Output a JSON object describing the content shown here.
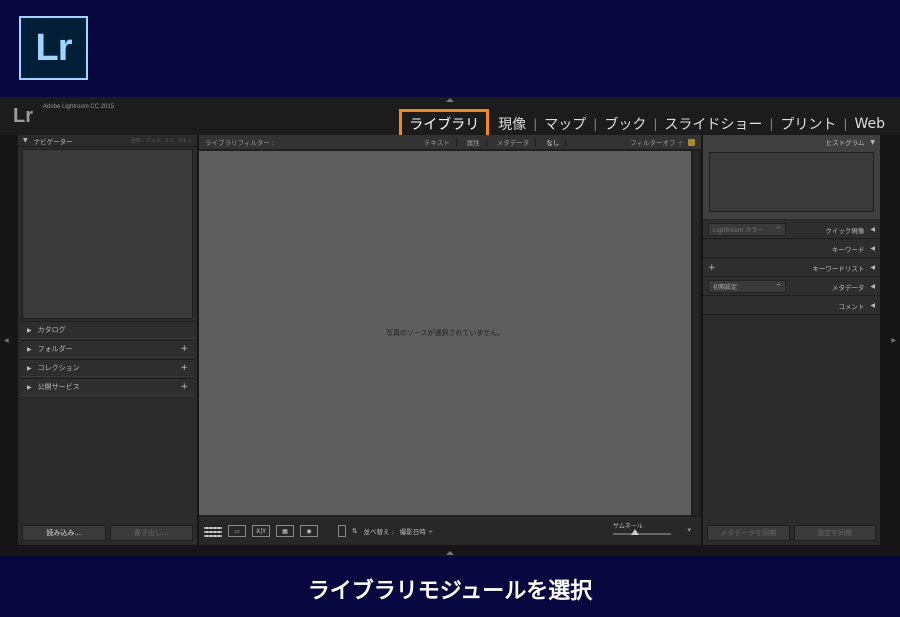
{
  "logo": {
    "text": "Lr"
  },
  "app": {
    "mini_logo": "Lr",
    "name": "Adobe Lightroom CC 2015"
  },
  "modules": [
    {
      "label": "ライブラリ",
      "active": true
    },
    {
      "label": "現像"
    },
    {
      "label": "マップ"
    },
    {
      "label": "ブック"
    },
    {
      "label": "スライドショー"
    },
    {
      "label": "プリント"
    },
    {
      "label": "Web"
    }
  ],
  "separator": "|",
  "left_panel": {
    "navigator": {
      "title": "ナビゲーター",
      "options": "全体 · フィル · 1:1 · 3:1 ÷"
    },
    "sections": [
      {
        "label": "カタログ",
        "plus": false
      },
      {
        "label": "フォルダー",
        "plus": true
      },
      {
        "label": "コレクション",
        "plus": true
      },
      {
        "label": "公開サービス",
        "plus": true
      }
    ],
    "plus_symbol": "+",
    "import_button": "読み込み...",
    "export_button": "書き出し..."
  },
  "filter_bar": {
    "label": "ライブラリフィルター :",
    "items": [
      "テキスト",
      "属性",
      "メタデータ",
      "なし"
    ],
    "selected": "なし",
    "filter_off": "フィルターオフ ÷"
  },
  "center": {
    "message": "写真のソースが選択されていません。"
  },
  "toolbar": {
    "view_modes": [
      "grid",
      "loupe",
      "XY",
      "survey",
      "people"
    ],
    "xy_label": "X|Y",
    "sort_label": "並べ替え :",
    "sort_value": "撮影日時 ÷",
    "thumbnail_label": "サムネール",
    "dropdown": "▾"
  },
  "right_panel": {
    "histogram_title": "ヒストグラム",
    "quick_develop": {
      "title": "クイック現像",
      "preset": "Lightroom カラー",
      "preset_arrow": "÷"
    },
    "keywording": {
      "title": "キーワード"
    },
    "keyword_list": {
      "title": "キーワードリスト"
    },
    "metadata": {
      "title": "メタデータ",
      "preset": "初期設定",
      "preset_arrow": "÷"
    },
    "comments": {
      "title": "コメント"
    },
    "sync_metadata_button": "メタデータを同期",
    "sync_settings_button": "設定を同期"
  },
  "caption": "ライブラリモジュールを選択",
  "colors": {
    "accent": "#f58a0b",
    "background": "#08073f",
    "lr_blue": "#9dd7ff"
  }
}
